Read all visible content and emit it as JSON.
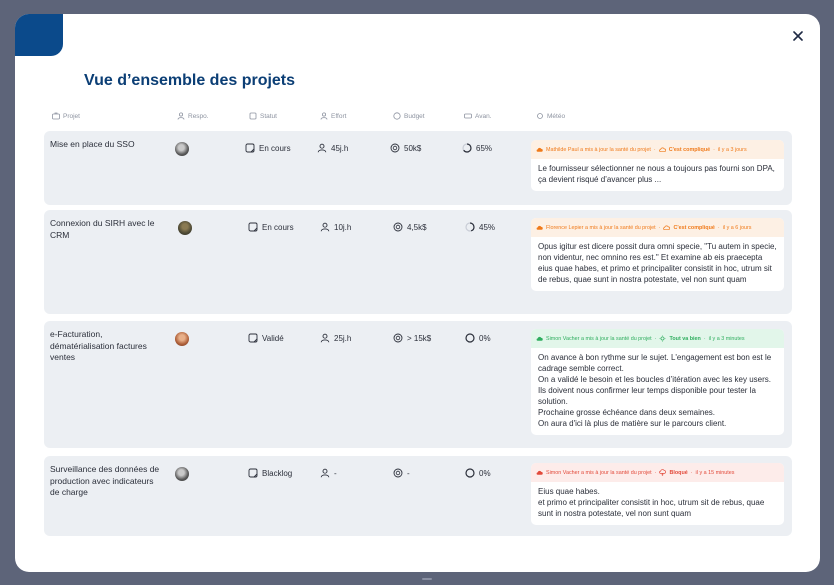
{
  "title": "Vue d’ensemble des projets",
  "columns": {
    "projet": "Projet",
    "respo": "Respo.",
    "statut": "Statut",
    "effort": "Effort",
    "budget": "Budget",
    "avan": "Avan.",
    "meteo": "Météo"
  },
  "rows": [
    {
      "name": "Mise en place du SSO",
      "statut": "En cours",
      "effort": "45j.h",
      "budget": "50k$",
      "avancement": "65%",
      "progress": 0.65,
      "meteo": {
        "author_note": "Mathilde Paul a mis à jour la santé du projet",
        "state": "C'est compliqué",
        "time": "il y a 3 jours",
        "text": "Le fournisseur sélectionner ne nous a toujours pas fourni son DPA, ça devient risqué d’avancer plus ..."
      }
    },
    {
      "name": "Connexion du SIRH avec le CRM",
      "statut": "En cours",
      "effort": "10j.h",
      "budget": "4,5k$",
      "avancement": "45%",
      "progress": 0.45,
      "meteo": {
        "author_note": "Florence Lepier a mis à jour la santé du projet",
        "state": "C'est compliqué",
        "time": "il y a 6 jours",
        "text": "Opus igitur est dicere possit dura omni specie, \"Tu autem in specie, non videntur, nec omnino res est.\" Et examine ab eis praecepta eius quae habes, et primo et principaliter consistit in hoc, utrum sit de rebus, quae sunt in nostra potestate, vel non sunt quam"
      }
    },
    {
      "name": "e-Facturation, dématérialisation factures ventes",
      "statut": "Validé",
      "effort": "25j.h",
      "budget": "> 15k$",
      "avancement": "0%",
      "progress": 0,
      "meteo": {
        "author_note": "Simon Vacher a mis à jour la santé du projet",
        "state": "Tout va bien",
        "time": "il y a 3 minutes",
        "text": "On avance à bon rythme sur le sujet. L'engagement est bon est le cadrage semble correct.\nOn a validé le besoin et les boucles d’itération avec les key users. Ils doivent nous confirmer leur temps disponible pour tester la solution.\nProchaine grosse échéance dans deux semaines.\nOn aura d'ici là plus de matière sur le parcours client."
      }
    },
    {
      "name": "Surveillance des données de production avec indicateurs de charge",
      "statut": "Blacklog",
      "effort": "-",
      "budget": "-",
      "avancement": "0%",
      "progress": 0,
      "meteo": {
        "author_note": "Simon Vacher a mis à jour la santé du projet",
        "state": "Bloqué",
        "time": "il y a 15 minutes",
        "text": "Eius quae habes.\n et primo et principaliter consistit in hoc, utrum sit de rebus, quae sunt in nostra potestate, vel non sunt quam"
      }
    }
  ],
  "colors": {
    "brand": "#0b4a8b",
    "title": "#0b3e75",
    "orange": "#f07a1a",
    "red": "#e24a3b",
    "green": "#2fae5f"
  }
}
